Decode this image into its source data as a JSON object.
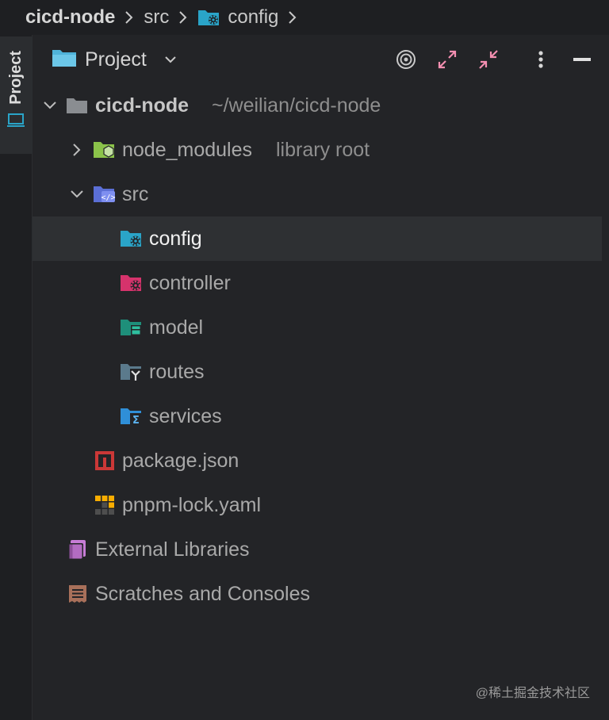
{
  "breadcrumb": {
    "items": [
      "cicd-node",
      "src",
      "config"
    ]
  },
  "tool_window": {
    "stripe_label": "Project",
    "title": "Project"
  },
  "tree": {
    "root": {
      "label": "cicd-node",
      "path": "~/weilian/cicd-node"
    },
    "node_modules": {
      "label": "node_modules",
      "suffix": "library root"
    },
    "src": {
      "label": "src"
    },
    "children": [
      "config",
      "controller",
      "model",
      "routes",
      "services"
    ],
    "package_json": "package.json",
    "pnpm_lock": "pnpm-lock.yaml",
    "external_libraries": "External Libraries",
    "scratches": "Scratches and Consoles"
  },
  "watermark": "@稀土掘金技术社区",
  "colors": {
    "config_folder": "#2aa4c8",
    "controller_folder": "#d6336c",
    "model_folder": "#1e8f7a",
    "routes_folder": "#5b7a8c",
    "services_folder": "#2f8fd8",
    "node_modules_folder": "#8bc34a",
    "src_folder": "#5b6fd6",
    "accent_pink": "#f48fb1"
  }
}
